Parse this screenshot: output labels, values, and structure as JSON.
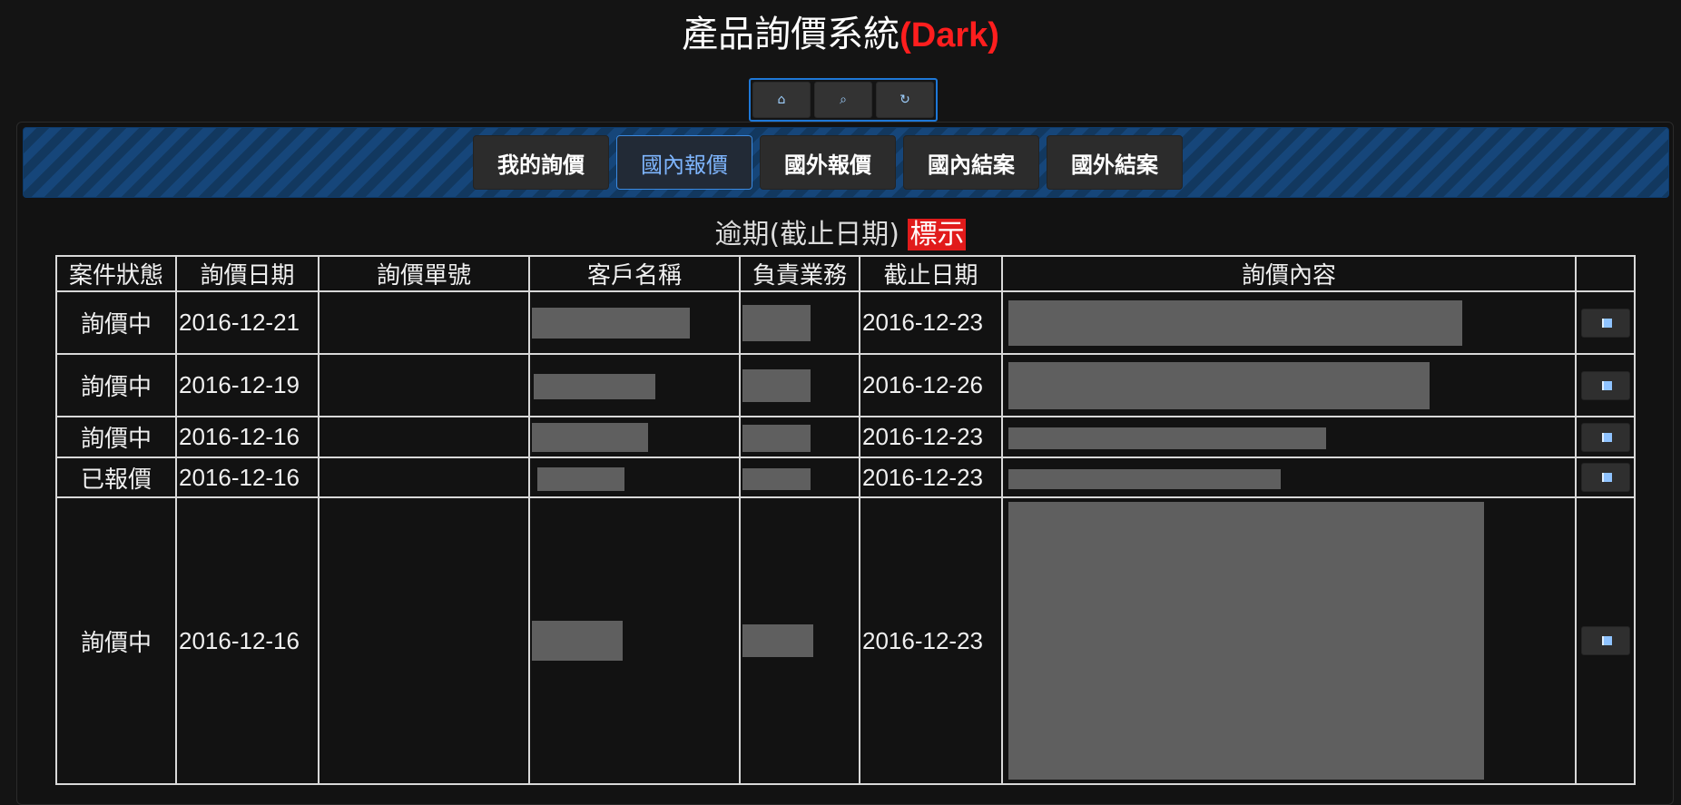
{
  "header": {
    "title_main": "產品詢價系統",
    "title_tag": "(Dark)"
  },
  "toolbar": {
    "buttons": [
      {
        "icon": "home-icon",
        "glyph": "⌂"
      },
      {
        "icon": "search-icon",
        "glyph": "⌕"
      },
      {
        "icon": "refresh-icon",
        "glyph": "↻"
      }
    ]
  },
  "tabs": [
    {
      "label": "我的詢價",
      "active": false
    },
    {
      "label": "國內報價",
      "active": true
    },
    {
      "label": "國外報價",
      "active": false
    },
    {
      "label": "國內結案",
      "active": false
    },
    {
      "label": "國外結案",
      "active": false
    }
  ],
  "legend": {
    "text": "逾期(截止日期)",
    "mark": "標示"
  },
  "table": {
    "headers": [
      "案件狀態",
      "詢價日期",
      "詢價單號",
      "客戶名稱",
      "負責業務",
      "截止日期",
      "詢價內容",
      ""
    ],
    "rows": [
      {
        "status": "詢價中",
        "inquiry_date": "2016-12-21",
        "number": "",
        "customer": "",
        "sales": "",
        "deadline": "2016-12-23",
        "content": ""
      },
      {
        "status": "詢價中",
        "inquiry_date": "2016-12-19",
        "number": "",
        "customer": "",
        "sales": "",
        "deadline": "2016-12-26",
        "content": ""
      },
      {
        "status": "詢價中",
        "inquiry_date": "2016-12-16",
        "number": "",
        "customer": "",
        "sales": "",
        "deadline": "2016-12-23",
        "content": ""
      },
      {
        "status": "已報價",
        "inquiry_date": "2016-12-16",
        "number": "",
        "customer": "",
        "sales": "",
        "deadline": "2016-12-23",
        "content": ""
      },
      {
        "status": "詢價中",
        "inquiry_date": "2016-12-16",
        "number": "",
        "customer": "",
        "sales": "",
        "deadline": "2016-12-23",
        "content": ""
      }
    ]
  },
  "colors": {
    "background": "#141414",
    "accent": "#1e78d8",
    "title_tag": "#ff1e1e",
    "overdue_mark": "#e11b1b",
    "redaction": "#5f5f5f"
  }
}
